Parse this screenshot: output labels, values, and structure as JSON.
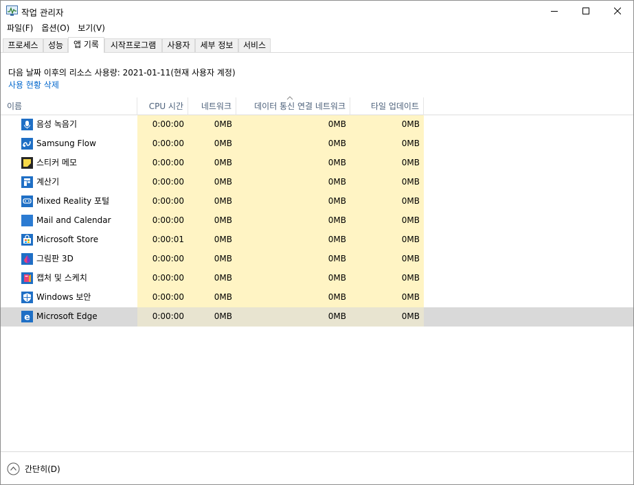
{
  "window": {
    "title": "작업 관리자"
  },
  "menu": [
    "파일(F)",
    "옵션(O)",
    "보기(V)"
  ],
  "tabs": [
    {
      "label": "프로세스",
      "active": false
    },
    {
      "label": "성능",
      "active": false
    },
    {
      "label": "앱 기록",
      "active": true
    },
    {
      "label": "시작프로그램",
      "active": false
    },
    {
      "label": "사용자",
      "active": false
    },
    {
      "label": "세부 정보",
      "active": false
    },
    {
      "label": "서비스",
      "active": false
    }
  ],
  "info": {
    "line": "다음 날짜 이후의 리소스 사용량: 2021-01-11(현재 사용자 계정)",
    "delete_link": "사용 현황 삭제"
  },
  "columns": {
    "name": "이름",
    "cpu": "CPU 시간",
    "network": "네트워크",
    "metered": "데이터 통신 연결 네트워크",
    "tile": "타일 업데이트"
  },
  "rows": [
    {
      "name": "음성 녹음기",
      "icon": "voice-recorder-icon",
      "cpu": "0:00:00",
      "network": "0MB",
      "metered": "0MB",
      "tile": "0MB"
    },
    {
      "name": "Samsung Flow",
      "icon": "samsung-flow-icon",
      "cpu": "0:00:00",
      "network": "0MB",
      "metered": "0MB",
      "tile": "0MB"
    },
    {
      "name": "스티커 메모",
      "icon": "sticky-notes-icon",
      "cpu": "0:00:00",
      "network": "0MB",
      "metered": "0MB",
      "tile": "0MB"
    },
    {
      "name": "계산기",
      "icon": "calculator-icon",
      "cpu": "0:00:00",
      "network": "0MB",
      "metered": "0MB",
      "tile": "0MB"
    },
    {
      "name": "Mixed Reality 포털",
      "icon": "mixed-reality-icon",
      "cpu": "0:00:00",
      "network": "0MB",
      "metered": "0MB",
      "tile": "0MB"
    },
    {
      "name": "Mail and Calendar",
      "icon": "mail-calendar-icon",
      "cpu": "0:00:00",
      "network": "0MB",
      "metered": "0MB",
      "tile": "0MB"
    },
    {
      "name": "Microsoft Store",
      "icon": "store-icon",
      "cpu": "0:00:01",
      "network": "0MB",
      "metered": "0MB",
      "tile": "0MB"
    },
    {
      "name": "그림판 3D",
      "icon": "paint3d-icon",
      "cpu": "0:00:00",
      "network": "0MB",
      "metered": "0MB",
      "tile": "0MB"
    },
    {
      "name": "캡처 및 스케치",
      "icon": "snip-sketch-icon",
      "cpu": "0:00:00",
      "network": "0MB",
      "metered": "0MB",
      "tile": "0MB"
    },
    {
      "name": "Windows 보안",
      "icon": "windows-security-icon",
      "cpu": "0:00:00",
      "network": "0MB",
      "metered": "0MB",
      "tile": "0MB"
    },
    {
      "name": "Microsoft Edge",
      "icon": "edge-icon",
      "cpu": "0:00:00",
      "network": "0MB",
      "metered": "0MB",
      "tile": "0MB",
      "selected": true
    }
  ],
  "footer": {
    "collapse_label": "간단히(D)"
  },
  "colors": {
    "accent": "#0066cc",
    "highlight": "#fff4c4",
    "selected_row": "#d9d9d9",
    "header_text": "#4c607a"
  }
}
